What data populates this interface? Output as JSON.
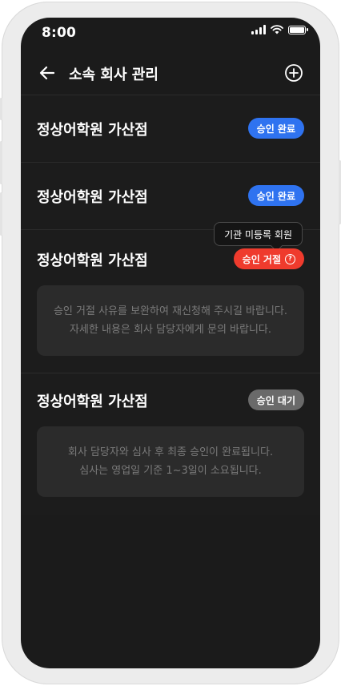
{
  "status_bar": {
    "time": "8:00"
  },
  "header": {
    "title": "소속 회사 관리",
    "back_icon": "arrow-left-icon",
    "add_icon": "plus-circle-icon"
  },
  "colors": {
    "approved": "#2f73f0",
    "rejected": "#ef3b2d",
    "pending": "#6a6a6a"
  },
  "companies": [
    {
      "name": "정상어학원 가산점",
      "status_label": "승인 완료",
      "status": "approved"
    },
    {
      "name": "정상어학원 가산점",
      "status_label": "승인 완료",
      "status": "approved"
    },
    {
      "name": "정상어학원 가산점",
      "status_label": "승인 거절",
      "status": "rejected",
      "tooltip": "기관 미등록 회원",
      "message_lines": [
        "승인 거절 사유를 보완하여 재신청해 주시길 바랍니다.",
        "자세한 내용은 회사 담당자에게 문의 바랍니다."
      ]
    },
    {
      "name": "정상어학원 가산점",
      "status_label": "승인 대기",
      "status": "pending",
      "message_lines": [
        "회사 담당자와 심사 후 최종 승인이 완료됩니다.",
        "심사는 영업일 기준 1~3일이 소요됩니다."
      ]
    }
  ]
}
